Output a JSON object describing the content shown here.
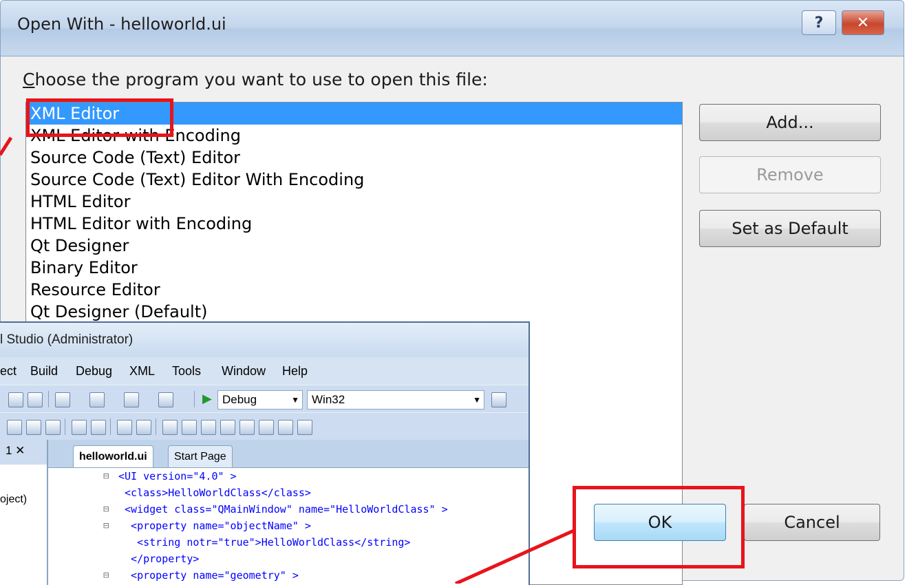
{
  "dialog": {
    "title": "Open With - helloworld.ui",
    "help_label": "?",
    "close_label": "✕",
    "prompt_prefix": "C",
    "prompt_rest": "hoose the program you want to use to open this file:",
    "programs": [
      "XML Editor",
      "XML Editor with Encoding",
      "Source Code (Text) Editor",
      "Source Code (Text) Editor With Encoding",
      "HTML Editor",
      "HTML Editor with Encoding",
      "Qt Designer",
      "Binary Editor",
      "Resource Editor",
      "Qt Designer (Default)"
    ],
    "selected_index": 0,
    "buttons": {
      "add": "Add...",
      "remove": "Remove",
      "set_default": "Set as Default",
      "ok": "OK",
      "cancel": "Cancel"
    }
  },
  "vs": {
    "title": "l Studio (Administrator)",
    "menu": [
      "ect",
      "Build",
      "Debug",
      "XML",
      "Tools",
      "Window",
      "Help"
    ],
    "config": "Debug",
    "platform": "Win32",
    "pane_close": "1 ✕",
    "pane_text": "oject)",
    "tabs": [
      "helloworld.ui",
      "Start Page"
    ],
    "code": [
      "<UI version=\"4.0\" >",
      " <class>HelloWorldClass</class>",
      " <widget class=\"QMainWindow\" name=\"HelloWorldClass\" >",
      "  <property name=\"objectName\" >",
      "   <string notr=\"true\">HelloWorldClass</string>",
      "  </property>",
      "  <property name=\"geometry\" >"
    ]
  },
  "colors": {
    "selection": "#3399ff",
    "highlight": "#e8141a"
  }
}
